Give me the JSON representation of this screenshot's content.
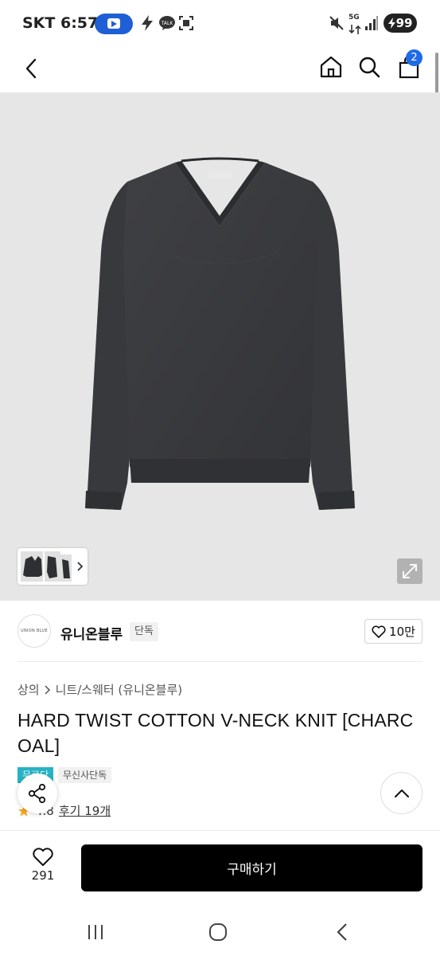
{
  "status_bar": {
    "carrier_time": "SKT 6:57",
    "network": "5G",
    "battery": "99"
  },
  "header": {
    "back_icon": "chevron-left-icon",
    "home_icon": "home-icon",
    "search_icon": "search-icon",
    "cart_icon": "cart-icon",
    "cart_count": "2"
  },
  "gallery": {
    "thumbnail_icon": "chevron-right-icon",
    "expand_icon": "expand-icon"
  },
  "brand": {
    "logo_text": "UNION BLUE",
    "name": "유니온블루",
    "tag": "단독",
    "like_count": "10만"
  },
  "product": {
    "breadcrumb": [
      "상의",
      "니트/스웨터 (유니온블루)"
    ],
    "title": "HARD TWIST COTTON V-NECK KNIT [CHARCOAL]",
    "badge_primary": "무료단",
    "badge_secondary": "무신사단독",
    "rating": "4.8",
    "review_link": "후기 19개"
  },
  "purchase": {
    "wish_count": "291",
    "buy_label": "구매하기"
  },
  "colors": {
    "accent": "#1f6ae6",
    "badge_teal": "#27b3c4",
    "star": "#f5a623",
    "sweater": "#3a3b3e"
  }
}
